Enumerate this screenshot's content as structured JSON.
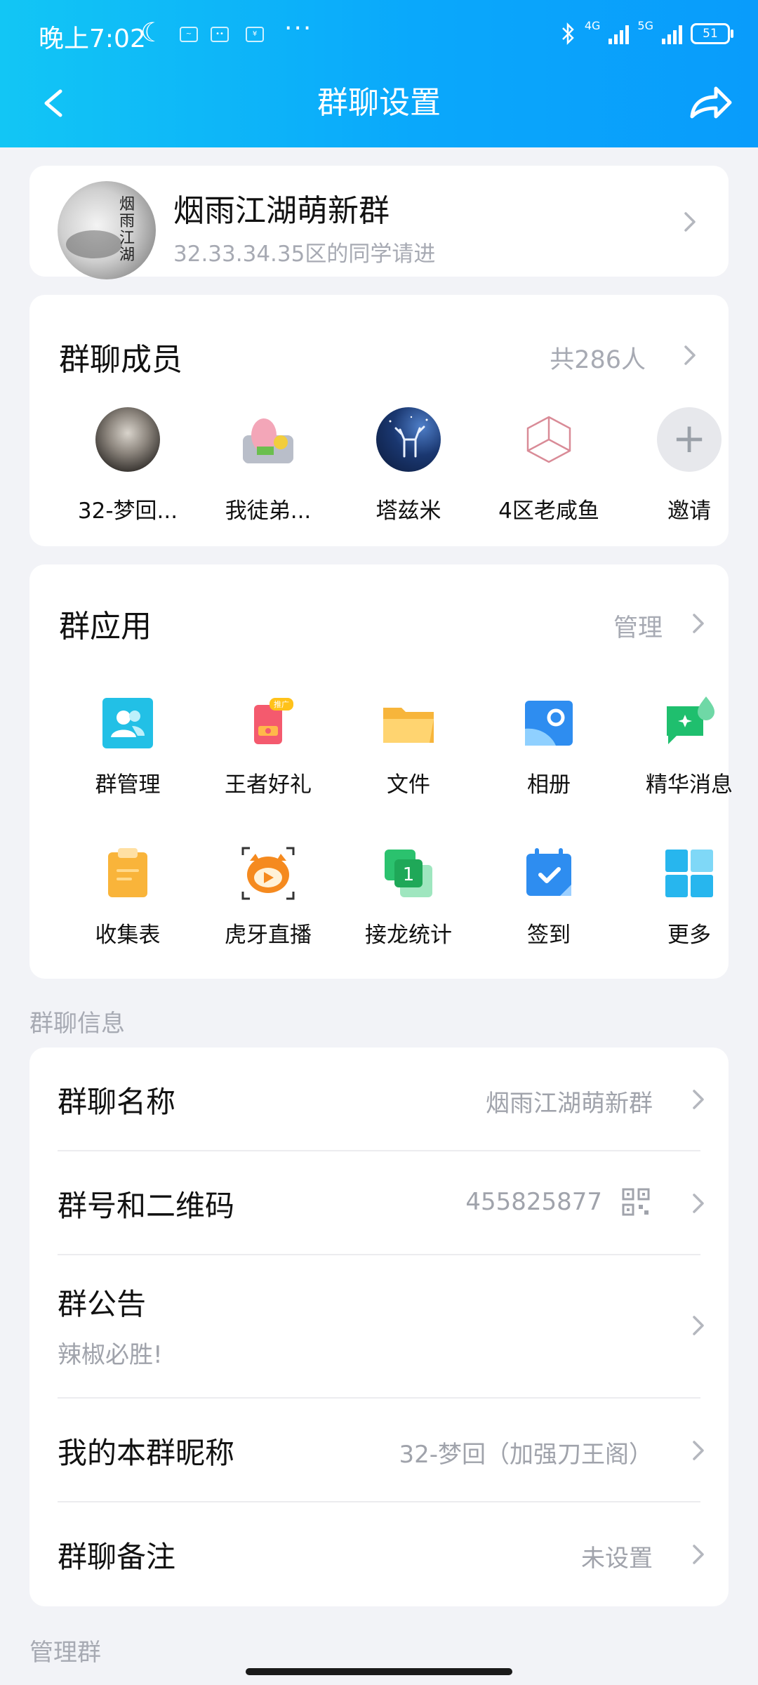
{
  "status_bar": {
    "time": "晚上7:02",
    "network_1": "4G",
    "network_2": "5G",
    "battery": "51"
  },
  "nav": {
    "title": "群聊设置",
    "back_icon": "chevron-left-icon",
    "share_icon": "share-icon"
  },
  "group": {
    "name": "烟雨江湖萌新群",
    "description": "32.33.34.35区的同学请进",
    "avatar_text": "烟雨江湖"
  },
  "members": {
    "title": "群聊成员",
    "count_label": "共286人",
    "list": [
      {
        "name": "32-梦回..."
      },
      {
        "name": "我徒弟..."
      },
      {
        "name": "塔兹米"
      },
      {
        "name": "4区老咸鱼"
      },
      {
        "name": "邀请"
      }
    ]
  },
  "apps": {
    "title": "群应用",
    "manage_label": "管理",
    "badge": "推广",
    "items": [
      {
        "label": "群管理",
        "icon": "group-manage-icon"
      },
      {
        "label": "王者好礼",
        "icon": "gift-icon"
      },
      {
        "label": "文件",
        "icon": "folder-icon"
      },
      {
        "label": "相册",
        "icon": "album-icon"
      },
      {
        "label": "精华消息",
        "icon": "essence-message-icon"
      },
      {
        "label": "收集表",
        "icon": "clipboard-icon"
      },
      {
        "label": "虎牙直播",
        "icon": "huya-live-icon"
      },
      {
        "label": "接龙统计",
        "icon": "relay-stats-icon"
      },
      {
        "label": "签到",
        "icon": "checkin-calendar-icon"
      },
      {
        "label": "更多",
        "icon": "more-grid-icon"
      }
    ]
  },
  "info": {
    "section_title": "群聊信息",
    "rows": [
      {
        "label": "群聊名称",
        "value": "烟雨江湖萌新群"
      },
      {
        "label": "群号和二维码",
        "value": "455825877"
      },
      {
        "label": "群公告",
        "value": "辣椒必胜!"
      },
      {
        "label": "我的本群昵称",
        "value": "32-梦回（加强刀王阁）"
      },
      {
        "label": "群聊备注",
        "value": "未设置"
      }
    ]
  },
  "manage": {
    "section_title": "管理群"
  },
  "colors": {
    "header_start": "#12c6f5",
    "header_end": "#099cfb",
    "background": "#f2f3f7",
    "secondary_text": "#a7aab3"
  }
}
